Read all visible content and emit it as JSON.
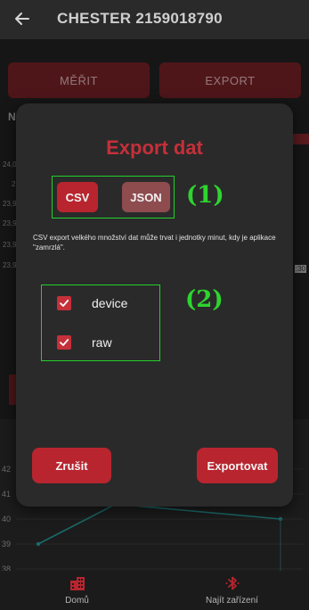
{
  "app": {
    "title": "CHESTER 2159018790",
    "back_icon": "arrow-left-icon",
    "buttons": {
      "measure": "MĚŘIT",
      "export": "EXPORT"
    }
  },
  "background_peek": {
    "letter": "N",
    "values": [
      "24,0",
      "2",
      "23,9",
      "23,9",
      "23,9",
      "23,9"
    ],
    "time": ":30"
  },
  "chart": {
    "y_ticks": [
      "42",
      "41",
      "40",
      "39",
      "38"
    ],
    "line_color": "#2aa3a3"
  },
  "chart_data": {
    "type": "line",
    "series": [
      {
        "values": [
          39,
          40.6,
          40
        ]
      }
    ],
    "ylim": [
      38,
      42
    ]
  },
  "dialog": {
    "title": "Export dat",
    "format": {
      "csv": "CSV",
      "json": "JSON",
      "selected": "CSV"
    },
    "annotation_1": "(1)",
    "annotation_2": "(2)",
    "note": "CSV export velkého množství dat může trvat i jednotky minut, kdy je aplikace \"zamrzlá\".",
    "options": [
      {
        "label": "device",
        "checked": true
      },
      {
        "label": "raw",
        "checked": true
      }
    ],
    "cancel": "Zrušit",
    "export": "Exportovat"
  },
  "nav": {
    "home": {
      "label": "Domů",
      "icon": "buildings-icon"
    },
    "find": {
      "label": "Najít zařízení",
      "icon": "bluetooth-icon"
    }
  },
  "colors": {
    "accent": "#c4303a",
    "button": "#b8252f",
    "annotation": "#22d02a"
  }
}
